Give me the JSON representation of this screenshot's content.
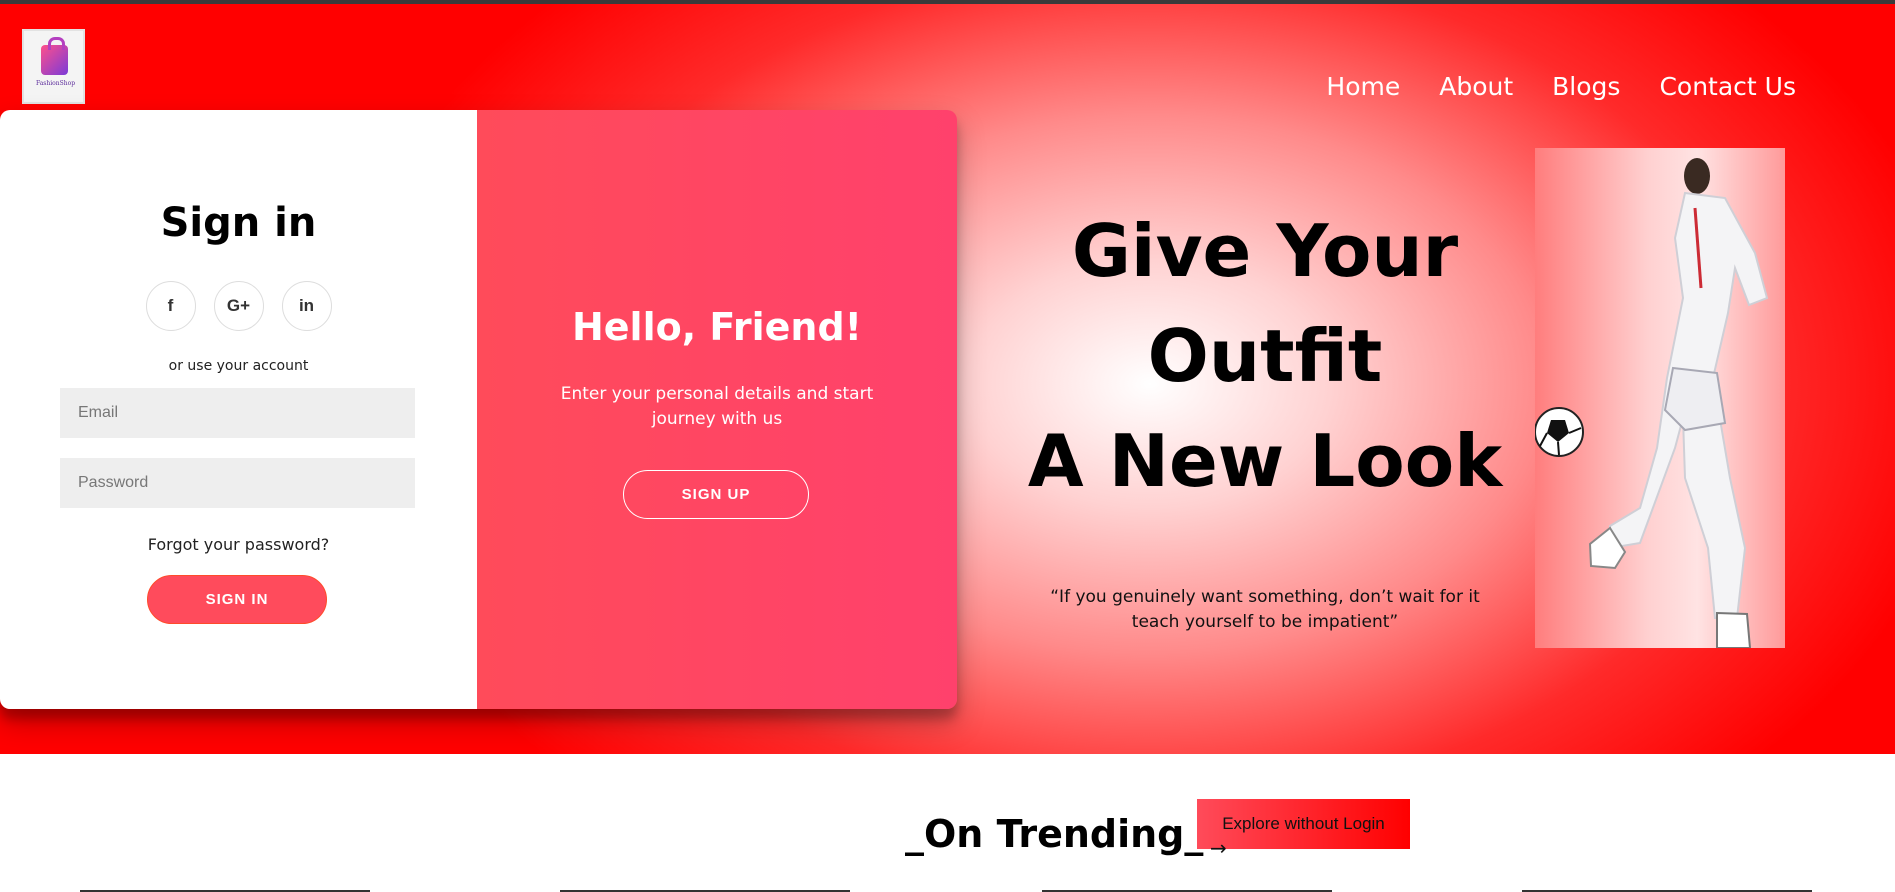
{
  "nav": {
    "logo_text": "FashionShop",
    "items": [
      "Home",
      "About",
      "Blogs",
      "Contact Us"
    ]
  },
  "signin": {
    "title": "Sign in",
    "social": [
      "f",
      "G+",
      "in"
    ],
    "alt_text": "or use your account",
    "email_placeholder": "Email",
    "password_placeholder": "Password",
    "forgot": "Forgot your password?",
    "button": "SIGN IN"
  },
  "overlay": {
    "title": "Hello, Friend!",
    "text": "Enter your personal details and start journey with us",
    "button": "SIGN UP"
  },
  "hero": {
    "line1": "Give Your",
    "line2": "Outfit",
    "line3": "A New Look",
    "quote": "“If you genuinely want something, don’t wait for it teach yourself to be impatient”"
  },
  "trending": {
    "title": "_On Trending_",
    "explore": "Explore without Login",
    "arrow": "→"
  },
  "colors": {
    "accent": "#ff4b5c",
    "hero_red": "#ff0000"
  }
}
